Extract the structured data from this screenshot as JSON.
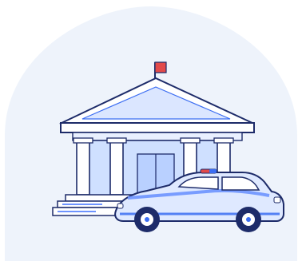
{
  "illustration": {
    "subject": "government-building-with-police-car",
    "icons": [
      "flag-icon",
      "courthouse-icon",
      "police-car-icon"
    ],
    "colors": {
      "backdrop": "#eef3fb",
      "building_fill": "#ffffff",
      "building_shade": "#cfe0ff",
      "accent_blue": "#3b6df2",
      "dark_navy": "#1d2b69",
      "flag_red": "#e24a4a"
    }
  }
}
